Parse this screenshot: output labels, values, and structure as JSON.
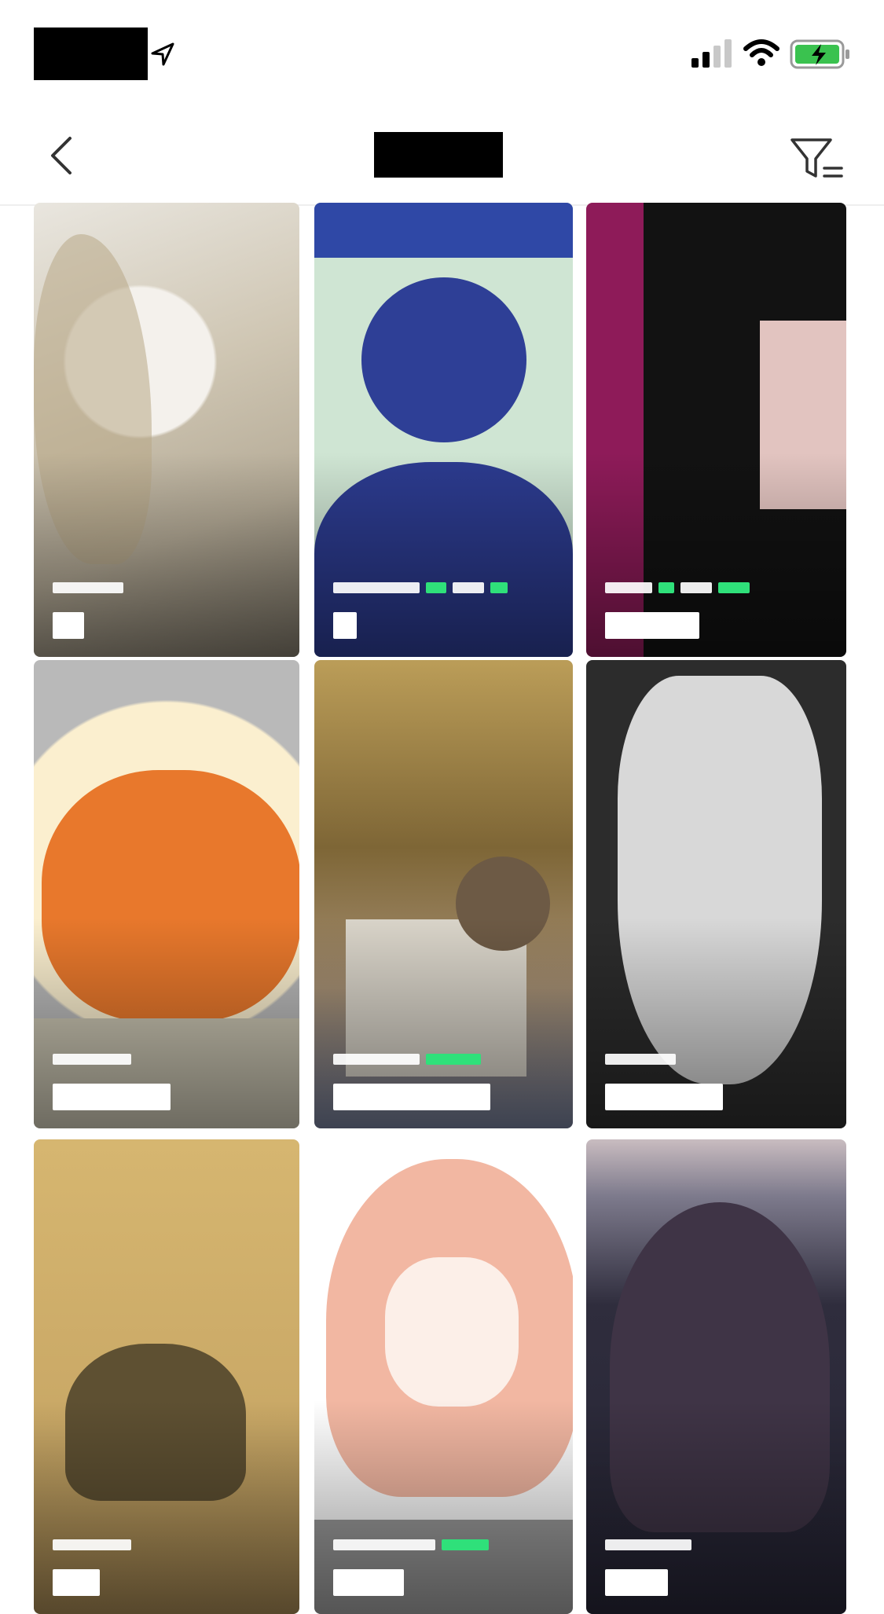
{
  "status_bar": {
    "time_redacted": true,
    "icons": [
      "location-arrow-icon",
      "cellular-signal-icon",
      "wifi-icon",
      "battery-charging-icon"
    ]
  },
  "nav": {
    "title": "",
    "back_icon": "chevron-left-icon",
    "filter_icon": "filter-icon"
  },
  "grid": {
    "columns": 3,
    "tiles": [
      {
        "art": "a1",
        "has_green_tags": false
      },
      {
        "art": "a2",
        "has_green_tags": true
      },
      {
        "art": "a3",
        "has_green_tags": true
      },
      {
        "art": "a4",
        "has_green_tags": false
      },
      {
        "art": "a5",
        "has_green_tags": true
      },
      {
        "art": "a6",
        "has_green_tags": false
      },
      {
        "art": "a7",
        "has_green_tags": false
      },
      {
        "art": "a8",
        "has_green_tags": true
      },
      {
        "art": "a9",
        "has_green_tags": false
      }
    ]
  },
  "colors": {
    "background": "#ffffff",
    "tag_green": "#2fe07a",
    "redaction": "#000000"
  }
}
